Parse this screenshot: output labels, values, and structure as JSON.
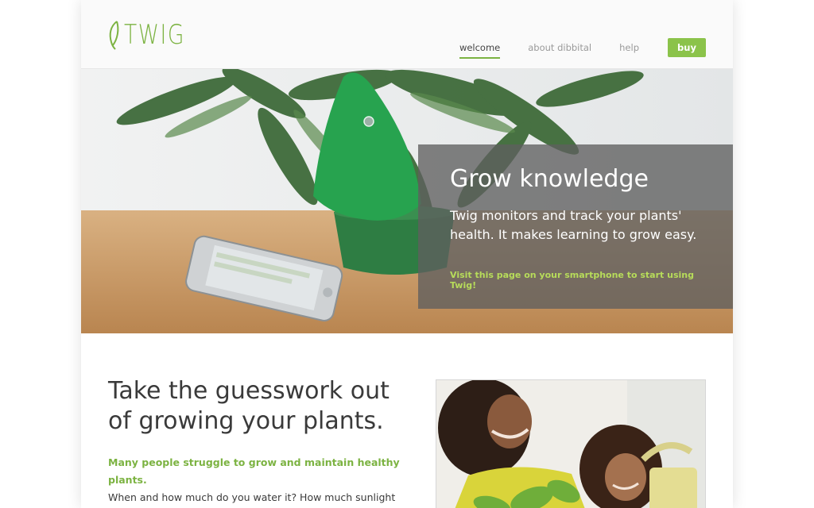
{
  "brand": {
    "logo_text": "TWIG",
    "accent_color": "#7cb342",
    "button_color": "#8bc34a"
  },
  "nav": {
    "items": [
      {
        "label": "welcome",
        "active": true
      },
      {
        "label": "about dibbital",
        "active": false
      },
      {
        "label": "help",
        "active": false
      }
    ],
    "buy_label": "buy"
  },
  "hero": {
    "title": "Grow knowledge",
    "text": "Twig monitors and track your plants' health. It makes learning to grow easy.",
    "cta": "Visit this page on your smartphone to start using Twig!",
    "panel_color": "#5f5f5f"
  },
  "content": {
    "heading": "Take the guesswork out of growing your plants.",
    "lead_highlight": "Many people struggle to grow and maintain healthy plants.",
    "lead_text": "When and how much do you water it? How much sunlight should it get? Twig answers all of these questions and"
  }
}
